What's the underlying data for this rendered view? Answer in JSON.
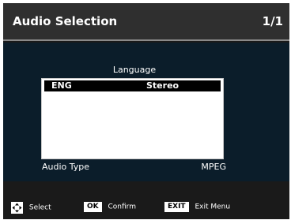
{
  "header": {
    "title": "Audio Selection",
    "page_indicator": "1/1"
  },
  "panel": {
    "language_label": "Language",
    "tracks": [
      {
        "language": "ENG",
        "mode": "Stereo",
        "selected": true
      }
    ],
    "audio_type_label": "Audio Type",
    "audio_type_value": "MPEG"
  },
  "footer": {
    "hints": [
      {
        "icon": "dpad-icon",
        "label": "Select"
      },
      {
        "key": "OK",
        "label": "Confirm"
      },
      {
        "key": "EXIT",
        "label": "Exit Menu"
      }
    ]
  }
}
